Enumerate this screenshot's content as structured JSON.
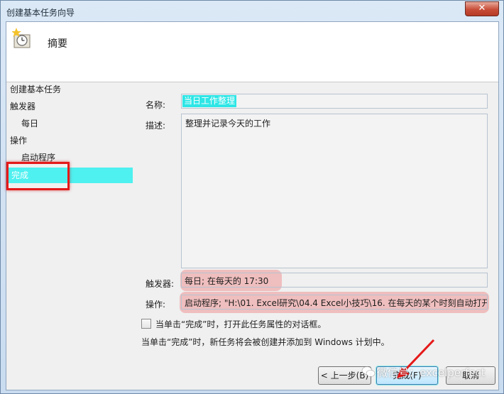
{
  "window": {
    "title": "创建基本任务向导",
    "close_glyph": "✕"
  },
  "header": {
    "title": "摘要",
    "icon": "task-clock-icon"
  },
  "nav": {
    "items": [
      {
        "label": "创建基本任务"
      },
      {
        "label": "触发器"
      },
      {
        "label": "每日"
      },
      {
        "label": "操作"
      },
      {
        "label": "启动程序"
      },
      {
        "label": "完成"
      }
    ]
  },
  "form": {
    "name_label": "名称:",
    "name_value": "当日工作整理",
    "desc_label": "描述:",
    "desc_value": "整理并记录今天的工作",
    "trigger_label": "触发器:",
    "trigger_value": "每日; 在每天的 17:30",
    "action_label": "操作:",
    "action_value": "启动程序; \"H:\\01. Excel研究\\04.4 Excel小技巧\\16. 在每天的某个时刻自动打开指",
    "checkbox_label": "当单击“完成”时，打开此任务属性的对话框。",
    "checkbox_checked": false,
    "info_text": "当单击“完成”时，新任务将会被创建并添加到 Windows 计划中。"
  },
  "buttons": {
    "back": "< 上一步(B)",
    "finish": "完成(F)",
    "cancel": "取消"
  },
  "watermark": {
    "text": "微信号：excelperfect"
  },
  "colors": {
    "highlight_cyan": "#4ff0f0",
    "annotation_red": "#e51919"
  }
}
